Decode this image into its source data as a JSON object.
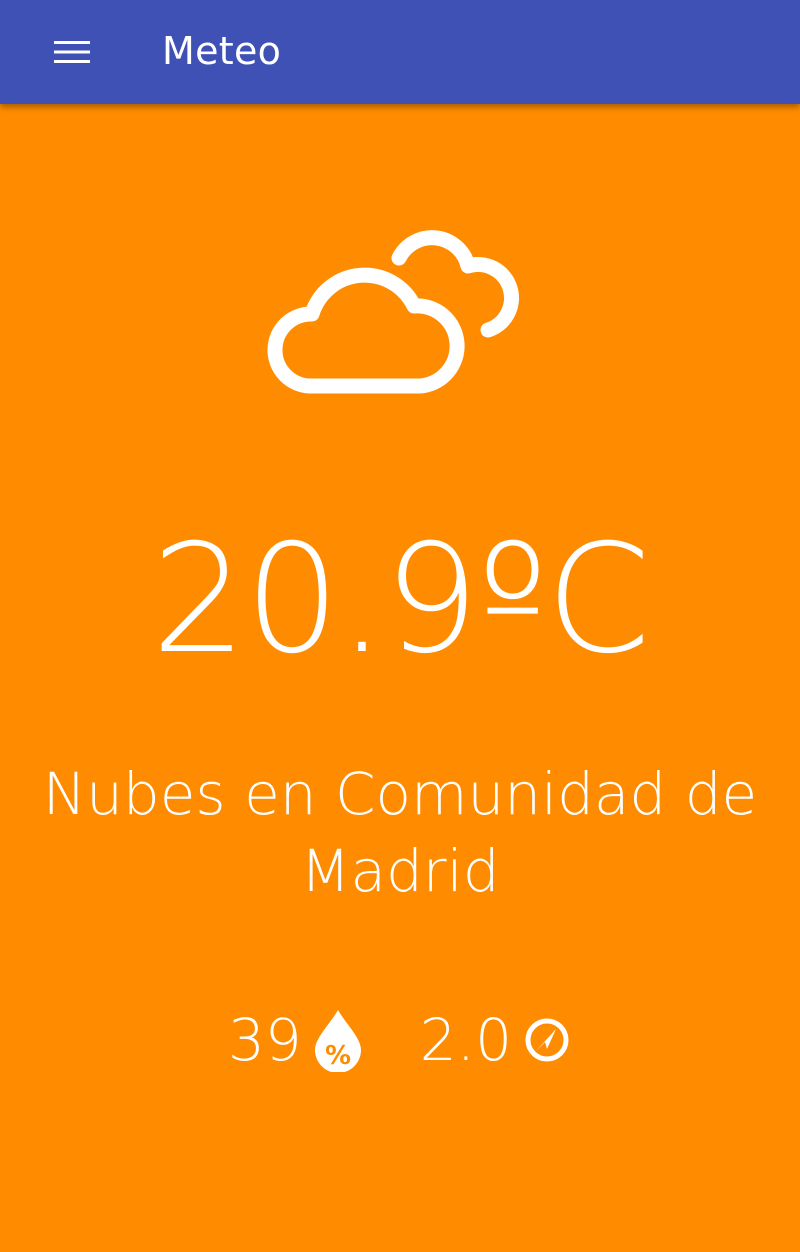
{
  "app_bar": {
    "title": "Meteo",
    "menu_icon": "menu-icon",
    "color": "#3F51B5"
  },
  "weather": {
    "background_color": "#FF8C00",
    "condition_icon": "cloudy-icon",
    "temperature": "20.9ºC",
    "description": "Nubes en Comunidad de Madrid",
    "humidity": {
      "value": "39",
      "icon": "humidity-percent-icon"
    },
    "wind": {
      "value": "2.0",
      "icon": "wind-direction-icon"
    }
  }
}
